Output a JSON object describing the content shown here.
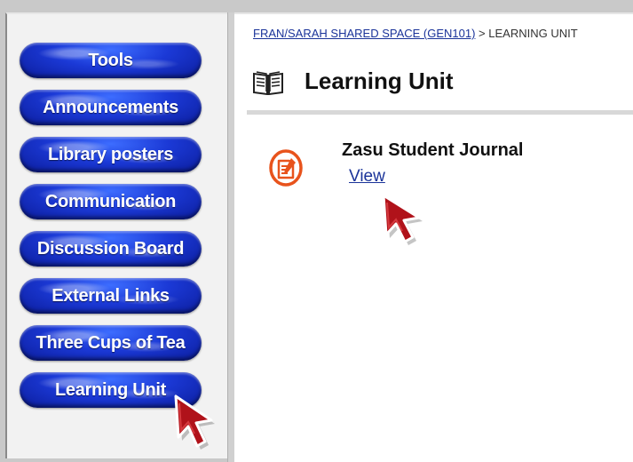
{
  "sidebar": {
    "items": [
      {
        "label": "Tools"
      },
      {
        "label": "Announcements"
      },
      {
        "label": "Library posters"
      },
      {
        "label": "Communication"
      },
      {
        "label": "Discussion Board"
      },
      {
        "label": "External Links"
      },
      {
        "label": "Three Cups of Tea"
      },
      {
        "label": "Learning Unit"
      }
    ]
  },
  "breadcrumb": {
    "course_link": "FRAN/SARAH SHARED SPACE (GEN101)",
    "separator": " > ",
    "current": "LEARNING UNIT"
  },
  "page": {
    "title": "Learning Unit",
    "icon": "book-icon"
  },
  "content": {
    "item": {
      "title": "Zasu Student Journal",
      "link_label": "View",
      "icon": "journal-tool-icon"
    }
  },
  "colors": {
    "button_blue": "#1b39d6",
    "link_blue": "#1a3399",
    "icon_orange": "#e8531c",
    "cursor_red": "#b0121a"
  }
}
